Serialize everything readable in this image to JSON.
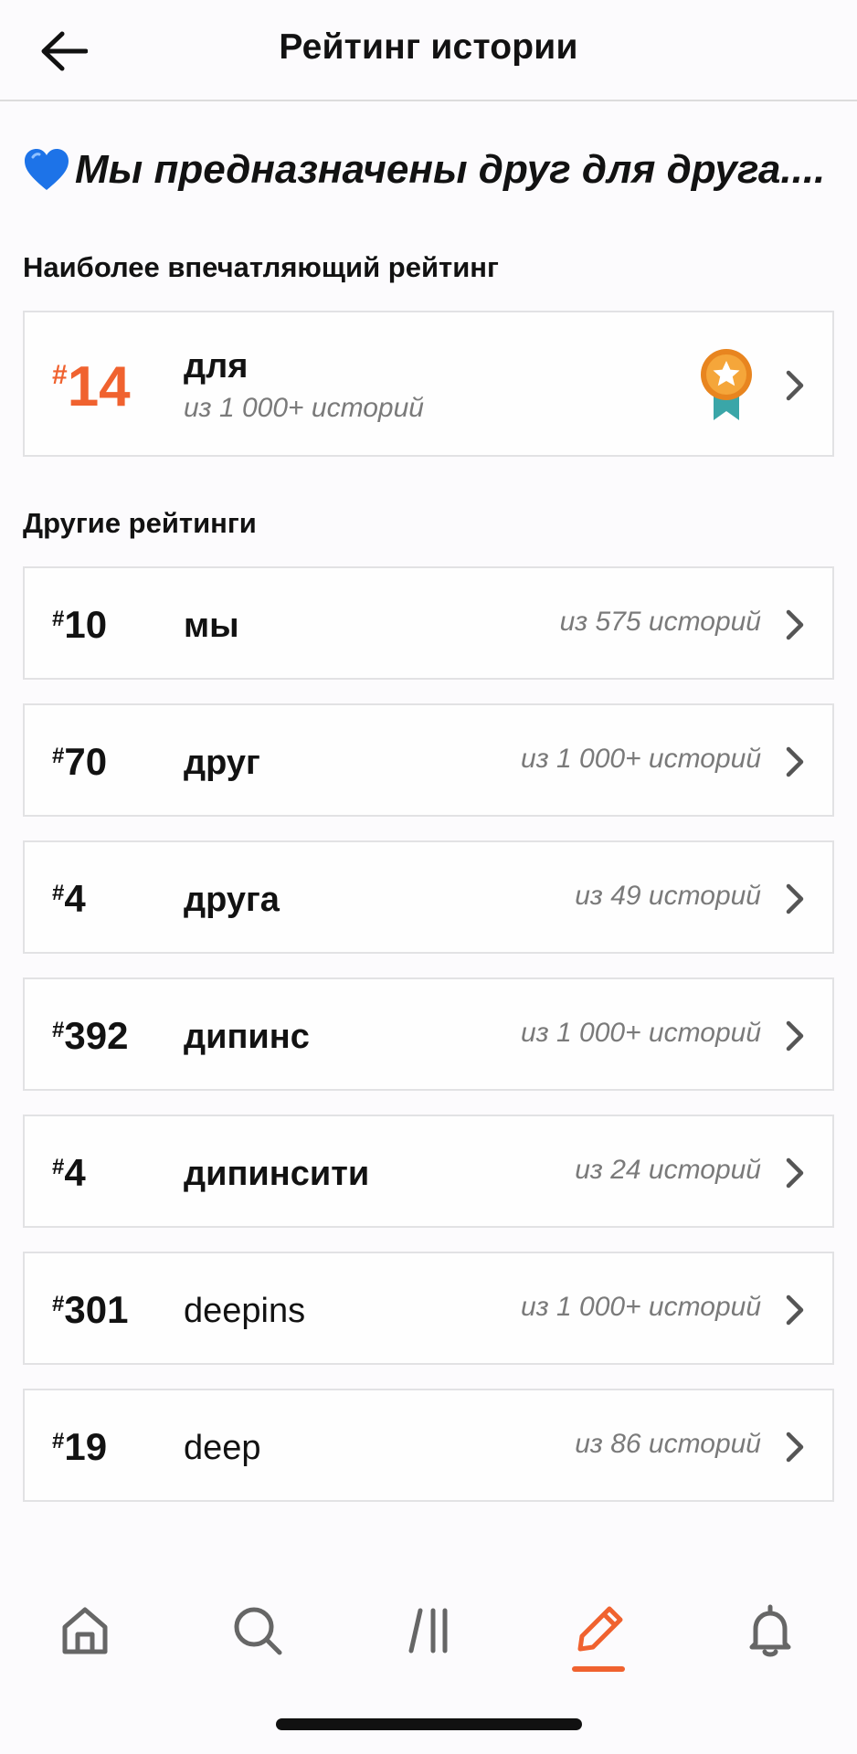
{
  "header": {
    "title": "Рейтинг истории",
    "back_icon": "arrow-left-icon"
  },
  "story": {
    "title": "Мы предназначены друг для друга....",
    "emoji_icon": "blue-heart-icon"
  },
  "best_section": {
    "heading": "Наиболее впечатляющий рейтинг",
    "item": {
      "hash": "#",
      "rank": "14",
      "tag": "для",
      "subtitle": "из 1 000+ историй",
      "badge_icon": "award-medal-icon"
    }
  },
  "other_section": {
    "heading": "Другие рейтинги",
    "items": [
      {
        "hash": "#",
        "rank": "10",
        "tag": "мы",
        "count": "из 575 историй"
      },
      {
        "hash": "#",
        "rank": "70",
        "tag": "друг",
        "count": "из 1 000+ историй"
      },
      {
        "hash": "#",
        "rank": "4",
        "tag": "друга",
        "count": "из 49 историй"
      },
      {
        "hash": "#",
        "rank": "392",
        "tag": "дипинс",
        "count": "из 1 000+ историй"
      },
      {
        "hash": "#",
        "rank": "4",
        "tag": "дипинсити",
        "count": "из 24 историй"
      },
      {
        "hash": "#",
        "rank": "301",
        "tag": "deepins",
        "count": "из 1 000+ историй"
      },
      {
        "hash": "#",
        "rank": "19",
        "tag": "deep",
        "count": "из 86 историй"
      }
    ]
  },
  "nav": {
    "items": [
      "home-icon",
      "search-icon",
      "library-icon",
      "pencil-icon",
      "bell-icon"
    ],
    "active": "pencil-icon",
    "active_color": "#f0622f"
  },
  "colors": {
    "accent": "#f0622f",
    "badge_orange": "#f29b2c",
    "badge_ribbon": "#3aa6a8",
    "heart": "#1d73e8"
  }
}
